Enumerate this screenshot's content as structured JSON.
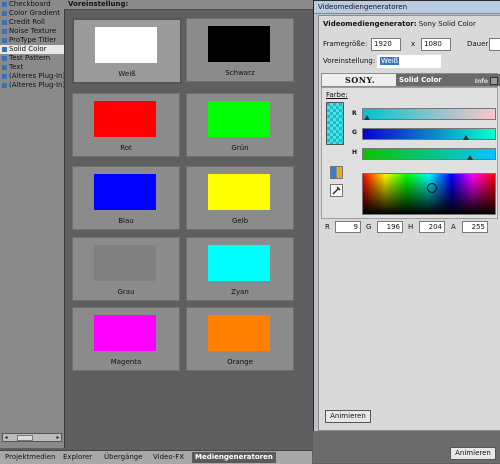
{
  "tree": {
    "items": [
      {
        "label": "Checkboard"
      },
      {
        "label": "Color Gradient"
      },
      {
        "label": "Credit Roll"
      },
      {
        "label": "Noise Texture"
      },
      {
        "label": "ProType Titler"
      },
      {
        "label": "Solid Color",
        "selected": true
      },
      {
        "label": "Test Pattern"
      },
      {
        "label": "Text"
      },
      {
        "label": "(Älteres Plug-In) T"
      },
      {
        "label": "(Älteres Plug-In) V"
      }
    ]
  },
  "presets": {
    "header": "Voreinstellung:",
    "tiles": [
      {
        "label": "Weiß",
        "color": "#ffffff",
        "selected": true
      },
      {
        "label": "Schwarz",
        "color": "#000000"
      },
      {
        "label": "Rot",
        "color": "#ff0000"
      },
      {
        "label": "Grün",
        "color": "#00ff00"
      },
      {
        "label": "Blau",
        "color": "#0000ff"
      },
      {
        "label": "Gelb",
        "color": "#ffff00"
      },
      {
        "label": "Grau",
        "color": "#808080"
      },
      {
        "label": "Zyan",
        "color": "#00ffff"
      },
      {
        "label": "Magenta",
        "color": "#ff00ff"
      },
      {
        "label": "Orange",
        "color": "#ff8000"
      }
    ]
  },
  "tabs": [
    {
      "label": "Projektmedien"
    },
    {
      "label": "Explorer"
    },
    {
      "label": "Übergänge"
    },
    {
      "label": "Video-FX"
    },
    {
      "label": "Mediengeneratoren",
      "active": true
    }
  ],
  "dialog": {
    "title": "Videomediengeneratoren",
    "generator_label": "Videomediengenerator:",
    "generator_value": "Sony Solid Color",
    "framesize_label": "Framegröße:",
    "width": "1920",
    "x": "x",
    "height": "1080",
    "duration_label": "Dauer:",
    "preset_label": "Voreinstellung:",
    "preset_value": "Weiß",
    "sony_logo": "SONY.",
    "plugin_title": "Solid Color",
    "info": "Info",
    "color_label": "Farbe:",
    "slider_labels": [
      "R",
      "G",
      "H"
    ],
    "r_label": "R",
    "r_value": "9",
    "g_label": "G",
    "g_value": "196",
    "h_label": "H",
    "h_value": "204",
    "a_label": "A",
    "a_value": "255",
    "animate_button": "Animieren"
  },
  "bottom": {
    "animate_button": "Animieren"
  }
}
